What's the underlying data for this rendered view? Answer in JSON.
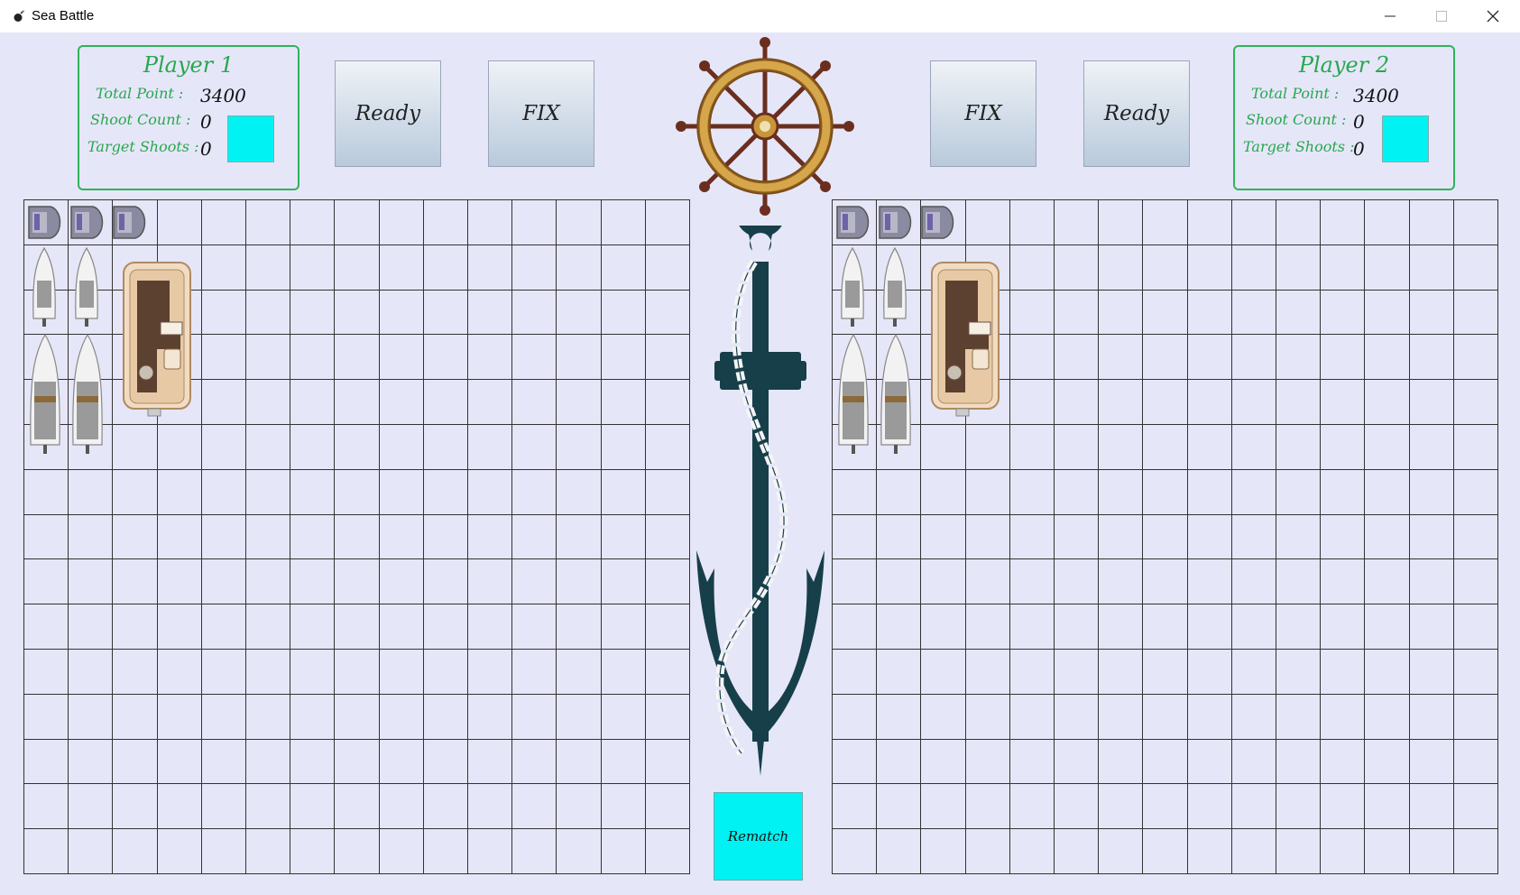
{
  "window": {
    "title": "Sea Battle"
  },
  "players": [
    {
      "name": "Player 1",
      "total_point_label": "Total Point :",
      "total_point": "3400",
      "shoot_count_label": "Shoot Count :",
      "shoot_count": "0",
      "target_shoots_label": "Target Shoots :",
      "target_shoots": "0",
      "shot_indicator_color": "#00f2f2"
    },
    {
      "name": "Player 2",
      "total_point_label": "Total Point :",
      "total_point": "3400",
      "shoot_count_label": "Shoot Count :",
      "shoot_count": "0",
      "target_shoots_label": "Target Shoots :",
      "target_shoots": "0",
      "shot_indicator_color": "#00f2f2"
    }
  ],
  "buttons": {
    "ready_label": "Ready",
    "fix_label": "FIX",
    "rematch_label": "Rematch"
  },
  "board": {
    "rows": 15,
    "cols": 15
  },
  "colors": {
    "background": "#e6e6f9",
    "accent_green": "#27a84d",
    "cyan": "#00f2f2",
    "anchor": "#163f4a",
    "wheel_wood": "#6b2e1e",
    "wheel_gold": "#c8963a"
  },
  "icons": {
    "app": "bomb-icon",
    "minimize": "minimize-icon",
    "maximize": "maximize-icon",
    "close": "close-icon",
    "wheel": "ship-wheel-icon",
    "anchor": "anchor-icon"
  }
}
